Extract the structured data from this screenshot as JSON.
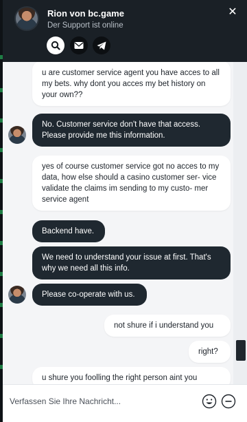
{
  "header": {
    "agent_name": "Rion von bc.game",
    "agent_status": "Der Support ist online",
    "close_label": "✕"
  },
  "messages": [
    {
      "from": "user",
      "text": "u are customer service agent you have acces to all my bets. why dont you acces my bet history on your own??"
    },
    {
      "from": "agent",
      "text": "No. Customer service don't have that access. Please provide me this information."
    },
    {
      "from": "user",
      "text": "yes of course customer service got no acces to my data, how else should a casino customer ser- vice validate the claims im sending to my custo- mer service agent"
    },
    {
      "from": "agent",
      "text": "Backend have."
    },
    {
      "from": "agent",
      "text": "We need to understand your issue at first. That's why we need all this info."
    },
    {
      "from": "agent",
      "text": "Please co-operate with us."
    },
    {
      "from": "user",
      "text": "not shure if i understand you"
    },
    {
      "from": "user",
      "text": "right?"
    },
    {
      "from": "user",
      "text": "u shure you foolling the right person aint you"
    }
  ],
  "composer": {
    "placeholder": "Verfassen Sie Ihre Nachricht..."
  },
  "colors": {
    "header_bg": "#1a2026",
    "agent_bubble": "#1f2830",
    "user_bubble": "#ffffff",
    "chat_bg": "#f4f5f7"
  }
}
